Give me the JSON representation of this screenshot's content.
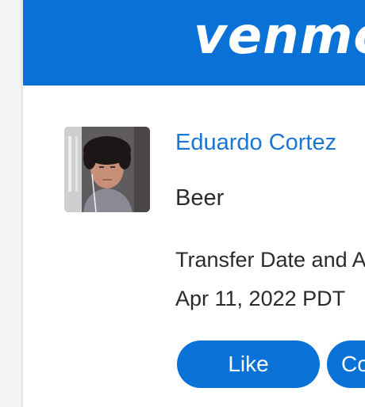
{
  "brand": {
    "logo_text": "venmo",
    "header_color": "#0a72d6"
  },
  "transaction": {
    "sender_name": "Eduardo Cortez",
    "note": "Beer",
    "transfer_label": "Transfer Date and Amount:",
    "transfer_date": "Apr 11, 2022 PDT"
  },
  "actions": {
    "like_label": "Like",
    "comment_label": "Comment"
  },
  "avatar": {
    "icon": "user-photo-icon"
  }
}
